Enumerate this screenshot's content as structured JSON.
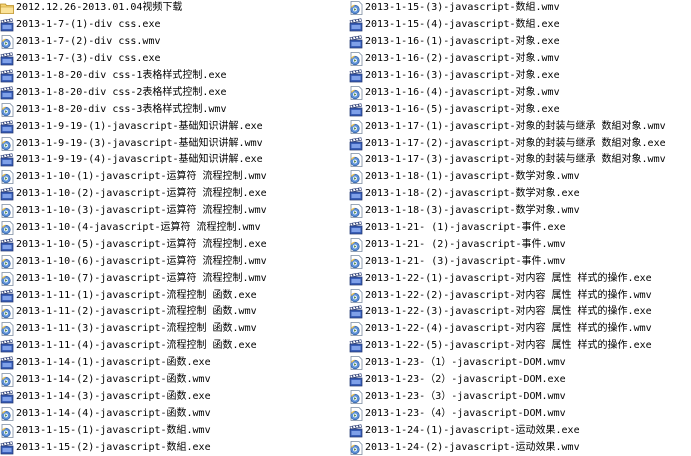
{
  "left_column": [
    {
      "name": "2012.12.26-2013.01.04视频下载",
      "type": "folder"
    },
    {
      "name": "2013-1-7-(1)-div css.exe",
      "type": "exe"
    },
    {
      "name": "2013-1-7-(2)-div css.wmv",
      "type": "wmv"
    },
    {
      "name": "2013-1-7-(3)-div css.exe",
      "type": "exe"
    },
    {
      "name": "2013-1-8-20-div css-1表格样式控制.exe",
      "type": "exe"
    },
    {
      "name": "2013-1-8-20-div css-2表格样式控制.exe",
      "type": "exe"
    },
    {
      "name": "2013-1-8-20-div css-3表格样式控制.wmv",
      "type": "wmv"
    },
    {
      "name": "2013-1-9-19-(1)-javascript-基础知识讲解.exe",
      "type": "exe"
    },
    {
      "name": "2013-1-9-19-(3)-javascript-基础知识讲解.wmv",
      "type": "wmv"
    },
    {
      "name": "2013-1-9-19-(4)-javascript-基础知识讲解.exe",
      "type": "exe"
    },
    {
      "name": "2013-1-10-(1)-javascript-运算符 流程控制.wmv",
      "type": "wmv"
    },
    {
      "name": "2013-1-10-(2)-javascript-运算符 流程控制.exe",
      "type": "exe"
    },
    {
      "name": "2013-1-10-(3)-javascript-运算符 流程控制.wmv",
      "type": "wmv"
    },
    {
      "name": "2013-1-10-(4-javascript-运算符 流程控制.wmv",
      "type": "wmv"
    },
    {
      "name": "2013-1-10-(5)-javascript-运算符 流程控制.exe",
      "type": "exe"
    },
    {
      "name": "2013-1-10-(6)-javascript-运算符 流程控制.wmv",
      "type": "wmv"
    },
    {
      "name": "2013-1-10-(7)-javascript-运算符 流程控制.wmv",
      "type": "wmv"
    },
    {
      "name": "2013-1-11-(1)-javascript-流程控制 函数.exe",
      "type": "exe"
    },
    {
      "name": "2013-1-11-(2)-javascript-流程控制 函数.wmv",
      "type": "wmv"
    },
    {
      "name": "2013-1-11-(3)-javascript-流程控制 函数.wmv",
      "type": "wmv"
    },
    {
      "name": "2013-1-11-(4)-javascript-流程控制 函数.exe",
      "type": "exe"
    },
    {
      "name": "2013-1-14-(1)-javascript-函数.exe",
      "type": "exe"
    },
    {
      "name": "2013-1-14-(2)-javascript-函数.wmv",
      "type": "wmv"
    },
    {
      "name": "2013-1-14-(3)-javascript-函数.exe",
      "type": "exe"
    },
    {
      "name": "2013-1-14-(4)-javascript-函数.wmv",
      "type": "wmv"
    },
    {
      "name": "2013-1-15-(1)-javascript-数組.wmv",
      "type": "wmv"
    },
    {
      "name": "2013-1-15-(2)-javascript-数組.exe",
      "type": "exe"
    }
  ],
  "right_column": [
    {
      "name": "2013-1-15-(3)-javascript-数組.wmv",
      "type": "wmv"
    },
    {
      "name": "2013-1-15-(4)-javascript-数組.exe",
      "type": "exe"
    },
    {
      "name": "2013-1-16-(1)-javascript-对象.exe",
      "type": "exe"
    },
    {
      "name": "2013-1-16-(2)-javascript-对象.wmv",
      "type": "wmv"
    },
    {
      "name": "2013-1-16-(3)-javascript-对象.exe",
      "type": "exe"
    },
    {
      "name": "2013-1-16-(4)-javascript-对象.wmv",
      "type": "wmv"
    },
    {
      "name": "2013-1-16-(5)-javascript-对象.exe",
      "type": "exe"
    },
    {
      "name": "2013-1-17-(1)-javascript-对象的封装与继承 数組对象.wmv",
      "type": "wmv"
    },
    {
      "name": "2013-1-17-(2)-javascript-对象的封装与继承 数組对象.exe",
      "type": "exe"
    },
    {
      "name": "2013-1-17-(3)-javascript-对象的封装与继承 数組对象.wmv",
      "type": "wmv"
    },
    {
      "name": "2013-1-18-(1)-javascript-数学对象.wmv",
      "type": "wmv"
    },
    {
      "name": "2013-1-18-(2)-javascript-数学对象.exe",
      "type": "exe"
    },
    {
      "name": "2013-1-18-(3)-javascript-数学对象.wmv",
      "type": "wmv"
    },
    {
      "name": "2013-1-21- (1)-javascript-事件.exe",
      "type": "exe"
    },
    {
      "name": "2013-1-21- (2)-javascript-事件.wmv",
      "type": "wmv"
    },
    {
      "name": "2013-1-21- (3)-javascript-事件.wmv",
      "type": "wmv"
    },
    {
      "name": "2013-1-22-(1)-javascript-对内容 属性 样式的操作.exe",
      "type": "exe"
    },
    {
      "name": "2013-1-22-(2)-javascript-对内容 属性 样式的操作.wmv",
      "type": "wmv"
    },
    {
      "name": "2013-1-22-(3)-javascript-对内容 属性 样式的操作.exe",
      "type": "exe"
    },
    {
      "name": "2013-1-22-(4)-javascript-对内容 属性 样式的操作.wmv",
      "type": "wmv"
    },
    {
      "name": "2013-1-22-(5)-javascript-对内容 属性 样式的操作.exe",
      "type": "exe"
    },
    {
      "name": "2013-1-23-（1）-javascript-DOM.wmv",
      "type": "wmv"
    },
    {
      "name": "2013-1-23-（2）-javascript-DOM.exe",
      "type": "exe"
    },
    {
      "name": "2013-1-23-（3）-javascript-DOM.wmv",
      "type": "wmv"
    },
    {
      "name": "2013-1-23-（4）-javascript-DOM.wmv",
      "type": "wmv"
    },
    {
      "name": "2013-1-24-(1)-javascript-运动效果.exe",
      "type": "exe"
    },
    {
      "name": "2013-1-24-(2)-javascript-运动效果.wmv",
      "type": "wmv"
    }
  ]
}
